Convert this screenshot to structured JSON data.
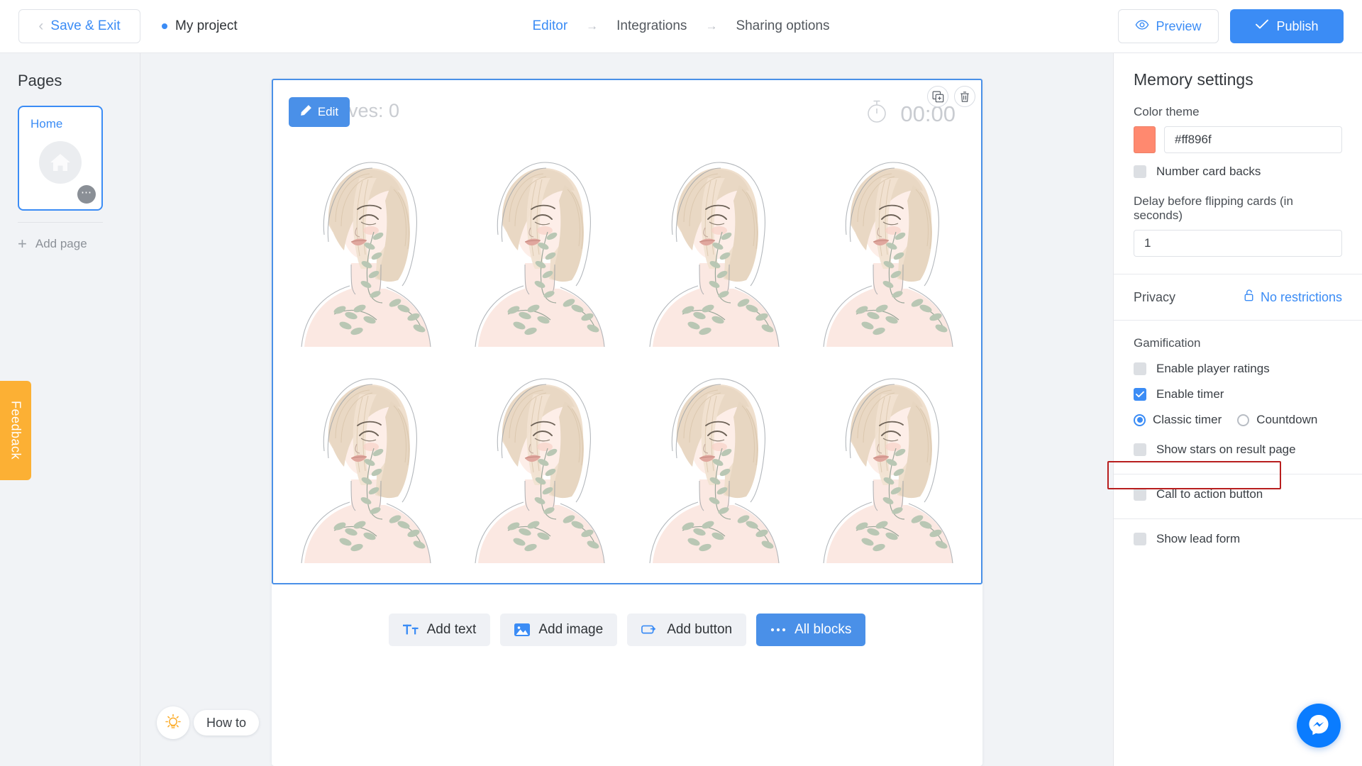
{
  "topbar": {
    "save_exit_label": "Save & Exit",
    "back_chevron_icon": "chevron-left-icon",
    "project_name": "My project",
    "breadcrumbs": [
      {
        "label": "Editor",
        "active": true
      },
      {
        "label": "Integrations",
        "active": false
      },
      {
        "label": "Sharing options",
        "active": false
      }
    ],
    "arrow_glyph": "→",
    "preview_label": "Preview",
    "preview_icon": "eye-icon",
    "publish_label": "Publish",
    "publish_icon": "check-icon",
    "accent_color": "#3b8cf5"
  },
  "sidebar": {
    "title": "Pages",
    "page": {
      "label": "Home",
      "icon": "home-icon",
      "menu_icon": "ellipsis-icon"
    },
    "add_page_label": "Add page",
    "add_page_icon": "plus-icon",
    "feedback_label": "Feedback",
    "feedback_color": "#fcb034"
  },
  "canvas": {
    "block": {
      "moves_label": "r of moves: 0",
      "timer_value": "00:00",
      "timer_icon": "stopwatch-icon",
      "edit_label": "Edit",
      "edit_icon": "pencil-icon",
      "duplicate_icon": "duplicate-icon",
      "delete_icon": "trash-icon",
      "card_count": 8,
      "card_alt": "illustration-woman-bob-haircut-botanical"
    },
    "block_buttons": [
      {
        "label": "Add text",
        "icon": "text-icon",
        "primary": false
      },
      {
        "label": "Add image",
        "icon": "image-icon",
        "primary": false
      },
      {
        "label": "Add button",
        "icon": "button-icon",
        "primary": false
      },
      {
        "label": "All blocks",
        "icon": "ellipsis-icon",
        "primary": true
      }
    ],
    "howto": {
      "label": "How to",
      "icon": "lightbulb-icon"
    }
  },
  "right_panel": {
    "title": "Memory settings",
    "color_theme": {
      "label": "Color theme",
      "value": "#ff896f",
      "swatch_color": "#ff896f"
    },
    "number_card_backs": {
      "label": "Number card backs",
      "checked": false
    },
    "delay": {
      "label": "Delay before flipping cards (in seconds)",
      "value": "1"
    },
    "privacy": {
      "label": "Privacy",
      "value": "No restrictions",
      "icon": "unlock-icon"
    },
    "gamification": {
      "title": "Gamification",
      "player_ratings": {
        "label": "Enable player ratings",
        "checked": false
      },
      "enable_timer": {
        "label": "Enable timer",
        "checked": true
      },
      "timer_mode": {
        "options": [
          "Classic timer",
          "Countdown"
        ],
        "selected": "Classic timer"
      },
      "show_stars": {
        "label": "Show stars on result page",
        "checked": false,
        "highlighted": true
      }
    },
    "cta_button": {
      "label": "Call to action button",
      "checked": false
    },
    "lead_form": {
      "label": "Show lead form",
      "checked": false
    }
  },
  "messenger": {
    "icon": "messenger-icon",
    "color": "#0a7cff"
  }
}
